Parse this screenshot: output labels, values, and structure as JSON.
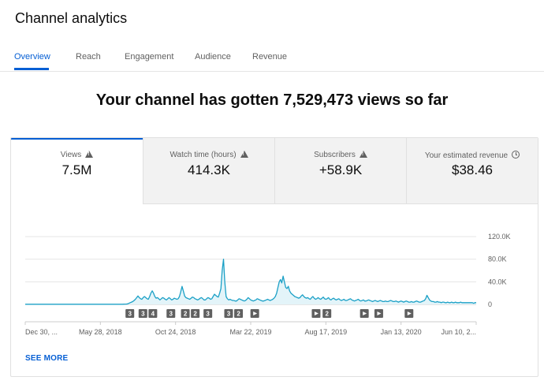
{
  "header": {
    "title": "Channel analytics"
  },
  "tabs": [
    {
      "label": "Overview"
    },
    {
      "label": "Reach"
    },
    {
      "label": "Engagement"
    },
    {
      "label": "Audience"
    },
    {
      "label": "Revenue"
    }
  ],
  "headline": "Your channel has gotten 7,529,473 views so far",
  "metrics": [
    {
      "label": "Views",
      "value": "7.5M",
      "icon": "warning-icon"
    },
    {
      "label": "Watch time (hours)",
      "value": "414.3K",
      "icon": "warning-icon"
    },
    {
      "label": "Subscribers",
      "value": "+58.9K",
      "icon": "warning-icon"
    },
    {
      "label": "Your estimated revenue",
      "value": "$38.46",
      "icon": "clock-icon"
    }
  ],
  "see_more": "SEE MORE",
  "colors": {
    "accent": "#065fd4",
    "line": "#1ba0c6",
    "fill": "#e3f4f9",
    "marker": "#606060"
  },
  "chart_data": {
    "type": "area",
    "series": [
      {
        "values": [
          0.3,
          0.3,
          0.3,
          0.3,
          0.3,
          0.3,
          0.3,
          0.3,
          0.3,
          0.3,
          0.3,
          0.3,
          0.3,
          0.3,
          0.3,
          0.3,
          0.3,
          0.3,
          0.3,
          0.3,
          0.3,
          0.3,
          0.3,
          0.3,
          0.3,
          0.3,
          0.3,
          0.3,
          0.3,
          0.3,
          0.3,
          0.3,
          0.3,
          0.3,
          0.3,
          0.3,
          0.3,
          0.3,
          0.3,
          0.3,
          0.3,
          0.3,
          0.3,
          0.3,
          0.3,
          0.3,
          0.3,
          0.3,
          0.3,
          0.3,
          0.3,
          0.3,
          0.3,
          0.3,
          0.3,
          0.3,
          0.3,
          0.3,
          0.3,
          0.3,
          0.3,
          0.3,
          0.3,
          0.3,
          0.3,
          0.3,
          0.3,
          0.3,
          0.3,
          0.3,
          0.3,
          0.3,
          0.3,
          0.3,
          0.3,
          0.3,
          0.4,
          0.5,
          0.6,
          1,
          2,
          3,
          4,
          5,
          7,
          9,
          12,
          15,
          12,
          10,
          9,
          12,
          14,
          12,
          10,
          9,
          14,
          20,
          24,
          20,
          14,
          11,
          12,
          10,
          8,
          10,
          12,
          11,
          9,
          8,
          10,
          12,
          10,
          8,
          9,
          11,
          10,
          9,
          10,
          14,
          22,
          32,
          24,
          15,
          12,
          11,
          10,
          9,
          11,
          13,
          12,
          10,
          9,
          8,
          9,
          11,
          12,
          10,
          8,
          8,
          10,
          12,
          11,
          9,
          10,
          14,
          18,
          16,
          14,
          13,
          20,
          28,
          60,
          80,
          40,
          14,
          10,
          8,
          9,
          8,
          7,
          7,
          6,
          6,
          8,
          10,
          9,
          8,
          7,
          6,
          7,
          9,
          12,
          10,
          8,
          7,
          6,
          7,
          8,
          10,
          9,
          8,
          7,
          6,
          6,
          7,
          8,
          9,
          8,
          7,
          8,
          9,
          11,
          14,
          20,
          30,
          40,
          44,
          38,
          50,
          40,
          30,
          28,
          32,
          24,
          20,
          18,
          16,
          14,
          13,
          12,
          11,
          12,
          15,
          17,
          14,
          12,
          11,
          12,
          10,
          9,
          12,
          14,
          11,
          9,
          10,
          12,
          10,
          9,
          11,
          13,
          10,
          9,
          10,
          12,
          9,
          8,
          10,
          11,
          9,
          8,
          9,
          10,
          8,
          7,
          8,
          9,
          7,
          7,
          8,
          9,
          10,
          8,
          7,
          6,
          7,
          8,
          9,
          7,
          6,
          7,
          8,
          6,
          6,
          7,
          8,
          7,
          6,
          5,
          6,
          7,
          6,
          5,
          6,
          7,
          6,
          5,
          5,
          6,
          5,
          5,
          6,
          7,
          6,
          5,
          5,
          6,
          5,
          4,
          5,
          6,
          5,
          4,
          5,
          6,
          5,
          4,
          4,
          5,
          4,
          4,
          5,
          6,
          5,
          4,
          4,
          5,
          6,
          7,
          10,
          16,
          12,
          8,
          6,
          5,
          5,
          4,
          4,
          5,
          4,
          4,
          3,
          4,
          4,
          3,
          3,
          4,
          3,
          3,
          4,
          3,
          3,
          4,
          3,
          3,
          3,
          4,
          3,
          3,
          3,
          3,
          3,
          3,
          3,
          3,
          3,
          2,
          3,
          3
        ]
      }
    ],
    "x_tick_labels": [
      "Dec 30, ...",
      "May 28, 2018",
      "Oct 24, 2018",
      "Mar 22, 2019",
      "Aug 17, 2019",
      "Jan 13, 2020",
      "Jun 10, 2..."
    ],
    "ylabel": "",
    "y_tick_labels": [
      "120.0K",
      "80.0K",
      "40.0K",
      "0"
    ],
    "y_ticks": [
      120,
      80,
      40,
      0
    ],
    "ylim": [
      0,
      120
    ],
    "y_unit": "K",
    "grid": true,
    "markers": [
      {
        "label": "3",
        "kind": "count",
        "at": 0.232
      },
      {
        "label": "3",
        "kind": "count",
        "at": 0.261
      },
      {
        "label": "4",
        "kind": "count",
        "at": 0.283
      },
      {
        "label": "3",
        "kind": "count",
        "at": 0.323
      },
      {
        "label": "2",
        "kind": "count",
        "at": 0.355
      },
      {
        "label": "2",
        "kind": "count",
        "at": 0.377
      },
      {
        "label": "3",
        "kind": "count",
        "at": 0.405
      },
      {
        "label": "3",
        "kind": "count",
        "at": 0.451
      },
      {
        "label": "2",
        "kind": "count",
        "at": 0.473
      },
      {
        "label": "",
        "kind": "play",
        "at": 0.509
      },
      {
        "label": "",
        "kind": "play",
        "at": 0.645
      },
      {
        "label": "2",
        "kind": "count",
        "at": 0.669
      },
      {
        "label": "",
        "kind": "play",
        "at": 0.752
      },
      {
        "label": "",
        "kind": "play",
        "at": 0.784
      },
      {
        "label": "",
        "kind": "play",
        "at": 0.851
      }
    ]
  }
}
